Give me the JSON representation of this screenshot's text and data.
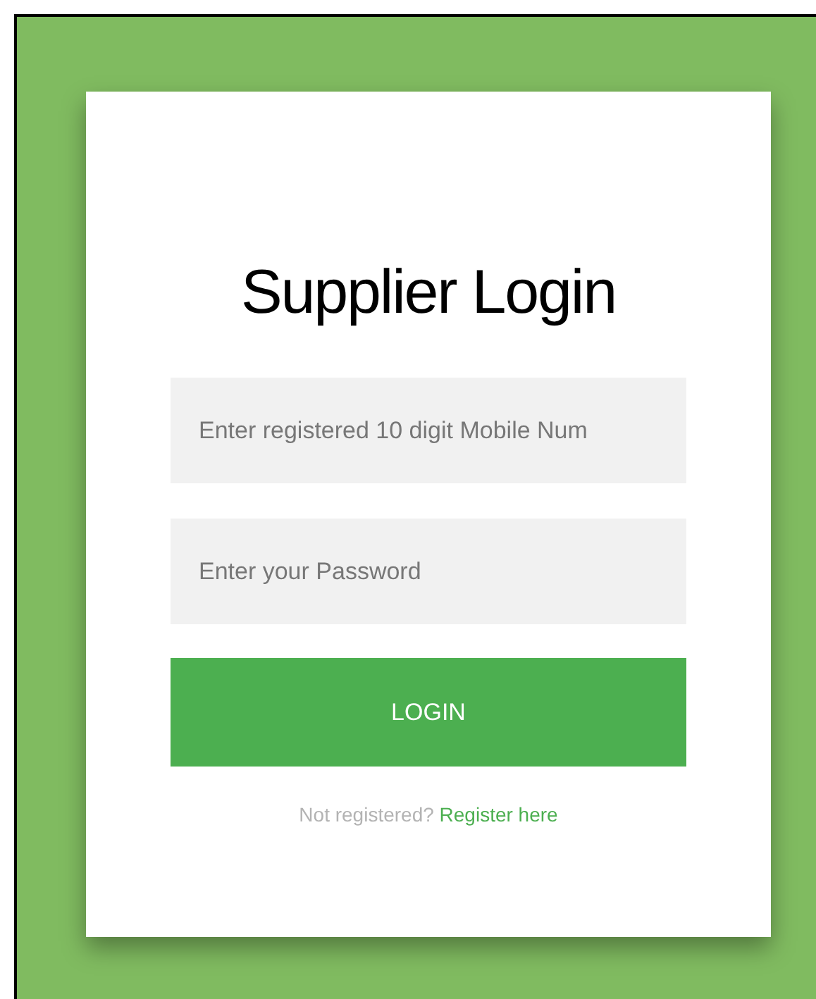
{
  "title": "Supplier Login",
  "fields": [
    {
      "placeholder": "Enter registered 10 digit Mobile Num"
    },
    {
      "placeholder": "Enter your Password"
    }
  ],
  "button": "LOGIN",
  "register": {
    "prompt": "Not registered?",
    "link": "Register here"
  }
}
